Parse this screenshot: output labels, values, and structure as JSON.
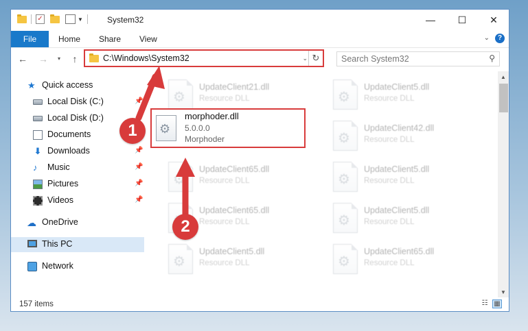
{
  "window": {
    "title": "System32",
    "minimize_glyph": "—",
    "maximize_glyph": "☐",
    "close_glyph": "✕"
  },
  "ribbon": {
    "tabs": [
      "File",
      "Home",
      "Share",
      "View"
    ],
    "expand_glyph": "⌄",
    "help_glyph": "?"
  },
  "nav": {
    "back_glyph": "←",
    "forward_glyph": "→",
    "up_glyph": "↑",
    "recent_glyph": "▾"
  },
  "address": {
    "path": "C:\\Windows\\System32",
    "dropdown_glyph": "⌄",
    "refresh_glyph": "↻"
  },
  "search": {
    "placeholder": "Search System32",
    "icon_glyph": "⚲"
  },
  "sidebar": {
    "items": [
      {
        "label": "Quick access",
        "icon": "star-icon",
        "pinned": false
      },
      {
        "label": "Local Disk (C:)",
        "icon": "disk-icon",
        "pinned": true
      },
      {
        "label": "Local Disk (D:)",
        "icon": "disk-icon",
        "pinned": false
      },
      {
        "label": "Documents",
        "icon": "documents-icon",
        "pinned": true
      },
      {
        "label": "Downloads",
        "icon": "download-icon",
        "pinned": true
      },
      {
        "label": "Music",
        "icon": "music-icon",
        "pinned": true
      },
      {
        "label": "Pictures",
        "icon": "pictures-icon",
        "pinned": true
      },
      {
        "label": "Videos",
        "icon": "videos-icon",
        "pinned": true
      },
      {
        "label": "OneDrive",
        "icon": "cloud-icon",
        "pinned": false
      },
      {
        "label": "This PC",
        "icon": "computer-icon",
        "pinned": false,
        "selected": true
      },
      {
        "label": "Network",
        "icon": "network-icon",
        "pinned": false
      }
    ],
    "pin_glyph": "📌"
  },
  "files": {
    "left_column": [
      {
        "name": "UpdateClient21.dll",
        "type": "Resource DLL"
      },
      {
        "name": "UpdateClient65.dll",
        "type": "Resource DLL"
      },
      {
        "name": "UpdateClient65.dll",
        "type": "Resource DLL"
      },
      {
        "name": "UpdateClient5.dll",
        "type": "Resource DLL"
      }
    ],
    "right_column": [
      {
        "name": "UpdateClient5.dll",
        "type": "Resource DLL"
      },
      {
        "name": "UpdateClient42.dll",
        "type": "Resource DLL"
      },
      {
        "name": "UpdateClient5.dll",
        "type": "Resource DLL"
      },
      {
        "name": "UpdateClient5.dll",
        "type": "Resource DLL"
      },
      {
        "name": "UpdateClient65.dll",
        "type": "Resource DLL"
      }
    ],
    "highlighted": {
      "name": "morphoder.dll",
      "version": "5.0.0.0",
      "description": "Morphoder"
    }
  },
  "statusbar": {
    "item_count": "157 items",
    "details_view_glyph": "☷",
    "tiles_view_glyph": "▦"
  },
  "annotations": {
    "step1": "1",
    "step2": "2",
    "color": "#d83b3b"
  }
}
